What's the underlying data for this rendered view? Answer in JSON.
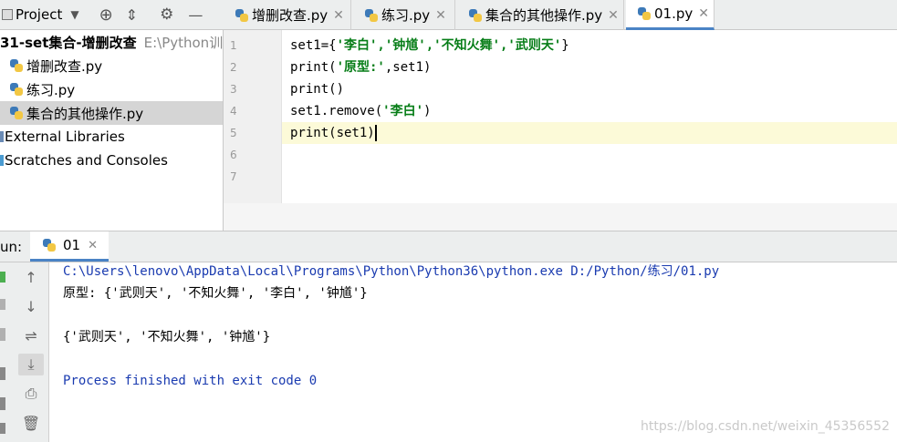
{
  "project": {
    "title": "Project"
  },
  "tree": {
    "root_label": "31-set集合-增删改查",
    "root_path": "E:\\Python训练",
    "files": [
      "增删改查.py",
      "练习.py",
      "集合的其他操作.py"
    ],
    "external": "External Libraries",
    "scratches": "Scratches and Consoles"
  },
  "tabs": [
    {
      "label": "增删改查.py"
    },
    {
      "label": "练习.py"
    },
    {
      "label": "集合的其他操作.py"
    },
    {
      "label": "01.py"
    }
  ],
  "editor": {
    "line_numbers": [
      "1",
      "2",
      "3",
      "4",
      "5",
      "6",
      "7"
    ],
    "lines": [
      {
        "plain_pre": "set1={",
        "str": "'李白','钟馗','不知火舞','武则天'",
        "plain_post": "}"
      },
      {
        "plain_pre": "print(",
        "str": "'原型:'",
        "plain_post": ",set1)"
      },
      {
        "plain_pre": "print()",
        "str": "",
        "plain_post": ""
      },
      {
        "plain_pre": "set1.remove(",
        "str": "'李白'",
        "plain_post": ")"
      },
      {
        "plain_pre": "print(set1)",
        "str": "",
        "plain_post": ""
      }
    ]
  },
  "run": {
    "label": "un:",
    "tab_label": "01",
    "output": [
      "C:\\Users\\lenovo\\AppData\\Local\\Programs\\Python\\Python36\\python.exe D:/Python/练习/01.py",
      "原型: {'武则天', '不知火舞', '李白', '钟馗'}",
      "",
      "{'武则天', '不知火舞', '钟馗'}",
      "",
      "Process finished with exit code 0"
    ]
  },
  "watermark": "https://blog.csdn.net/weixin_45356552",
  "colors": {
    "accent": "#4a83c5",
    "string": "#067d17",
    "console_blue": "#1a3bb0"
  }
}
